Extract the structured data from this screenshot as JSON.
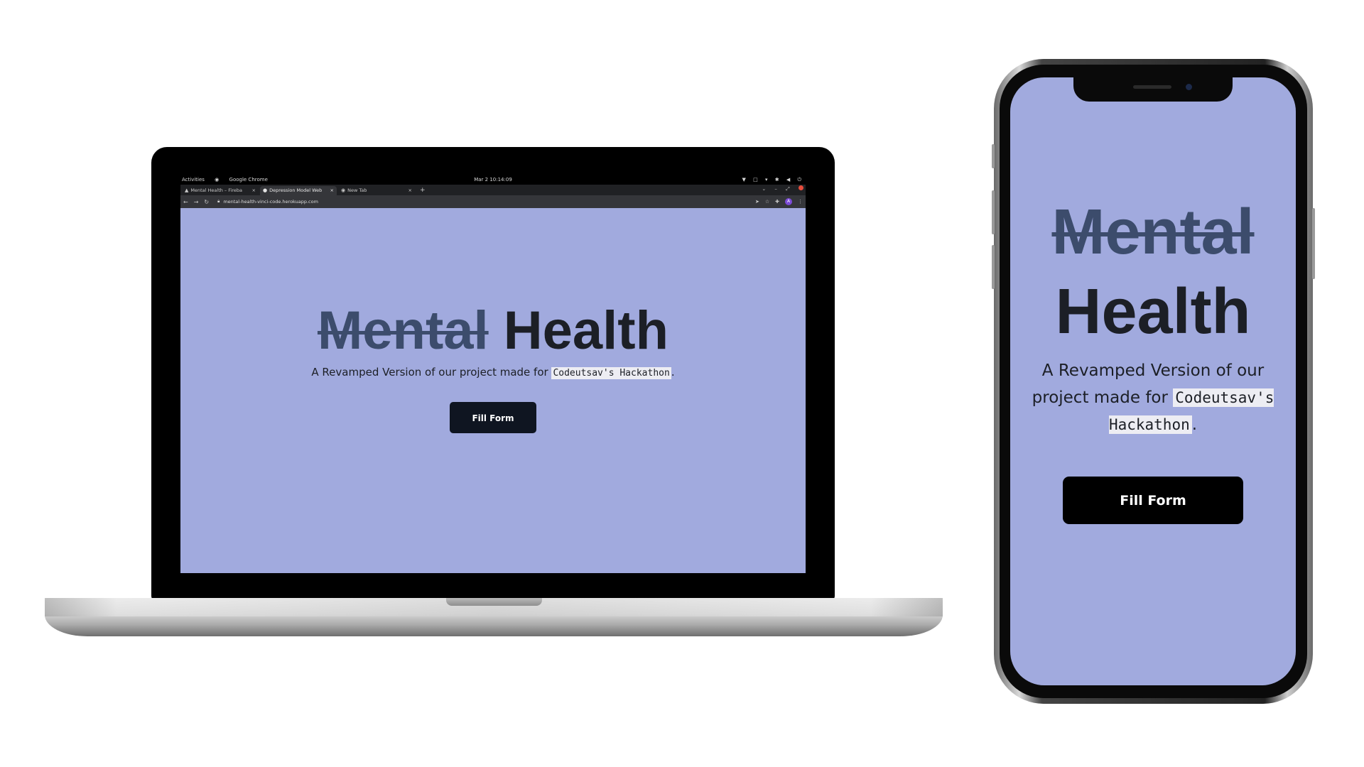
{
  "os_bar": {
    "activities": "Activities",
    "app_name": "Google Chrome",
    "clock": "Mar 2 10:14:09"
  },
  "browser": {
    "tabs": [
      {
        "label": "Mental Health – Fireba",
        "active": false
      },
      {
        "label": "Depression Model Web",
        "active": true
      },
      {
        "label": "New Tab",
        "active": false
      }
    ],
    "new_tab_label": "+",
    "url": "mental-health-vinci-code.herokuapp.com",
    "profile_initial": "A"
  },
  "hero": {
    "struck_word": "Mental",
    "title_word": "Health",
    "subtitle_prefix": "A Revamped Version of our project made for ",
    "subtitle_code": "Codeutsav's Hackathon",
    "subtitle_suffix": ".",
    "cta_label": "Fill Form"
  },
  "mobile": {
    "struck_word": "Mental",
    "title_word": "Health",
    "subtitle_prefix": "A Revamped Version of our project made for ",
    "subtitle_code": "Codeutsav's Hackathon",
    "subtitle_suffix": ".",
    "cta_label": "Fill Form"
  },
  "colors": {
    "page_background": "#a1aade",
    "struck_text": "#3c4c6c",
    "button": "#0f1521"
  },
  "icons": [
    "chrome-icon",
    "firebase-icon",
    "github-icon",
    "back-icon",
    "forward-icon",
    "reload-icon",
    "lock-icon",
    "share-icon",
    "star-icon",
    "extensions-icon",
    "menu-icon"
  ]
}
